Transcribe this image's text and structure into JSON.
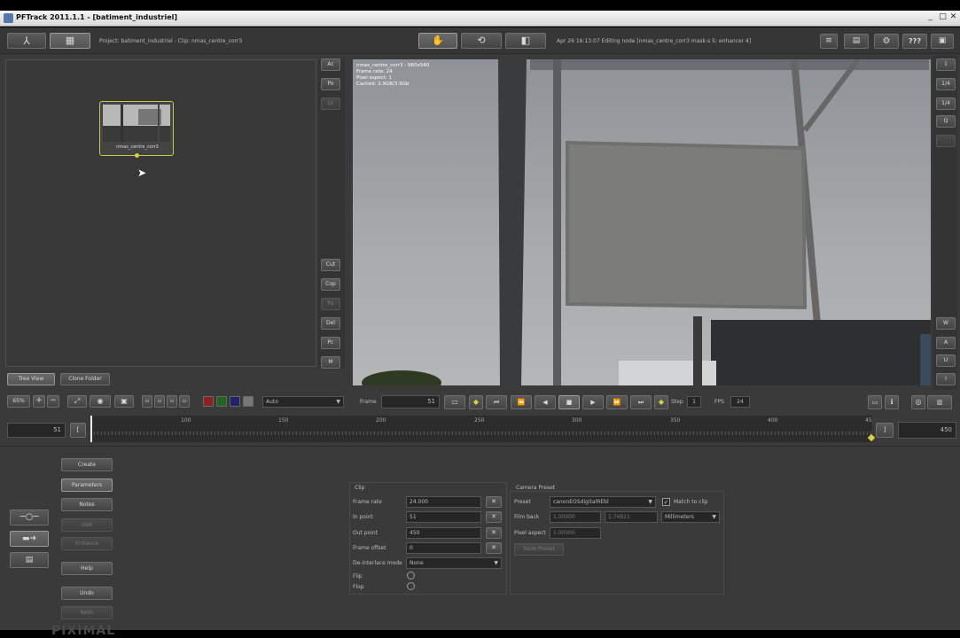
{
  "window": {
    "title": "PFTrack 2011.1.1 - [batiment_industriel]"
  },
  "header": {
    "project_info": "Project: batiment_industriel - Clip: nmas_centre_corr3",
    "status_text": "Apr 26 16:13:07 Editing node [nmas_centre_corr3 mask-s 5; enhancer 4]",
    "help_label": "???"
  },
  "node_tree": {
    "node_label": "nmas_centre_corr3",
    "side_buttons": [
      "Cut",
      "Cop",
      "Pa",
      "Del",
      "Pc",
      "M"
    ],
    "top_buttons": [
      "Ac",
      "Po",
      "Lk"
    ],
    "tabs": [
      "Tree View",
      "Clone Folder"
    ]
  },
  "viewer": {
    "overlay": [
      "nmas_centre_corr3 - 960x540",
      "Frame rate: 24",
      "Pixel aspect: 1",
      "Cached: 1.9GB/3.9Gb"
    ],
    "right_buttons": [
      "1",
      "1/4",
      "1/4",
      "Q",
      "",
      "W",
      "A",
      "U",
      "I"
    ]
  },
  "toolbar": {
    "zoom": "65%",
    "mode_select": "Auto",
    "frame_label": "Frame",
    "frame_value": "51",
    "step_label": "Step",
    "step_value": "1",
    "fps_label": "FPS",
    "fps_value": "24"
  },
  "timeline": {
    "start_frame": "51",
    "end_frame": "450",
    "ticks": [
      "100",
      "150",
      "200",
      "250",
      "300",
      "350",
      "400",
      "45"
    ]
  },
  "left_menu": [
    "Create",
    "Parameters",
    "Notes",
    "Vast",
    "Enhance",
    "Help",
    "Undo",
    "Redo"
  ],
  "clip_panel": {
    "title": "Clip",
    "rows": [
      {
        "label": "Frame rate",
        "value": "24.000"
      },
      {
        "label": "In point",
        "value": "51"
      },
      {
        "label": "Out point",
        "value": "450"
      },
      {
        "label": "Frame offset",
        "value": "0"
      }
    ],
    "deinterlace_label": "De-interlace mode",
    "deinterlace_value": "None",
    "flip_label": "Flip",
    "flop_label": "Flop"
  },
  "camera_panel": {
    "title": "Camera Preset",
    "preset_label": "Preset",
    "preset_value": "canonEOSdigitalREbl",
    "match_label": "Match to clip",
    "film_back_label": "Film back",
    "film_back_w": "1.00000",
    "film_back_h": "1.74811",
    "units_value": "Millimeters",
    "pixel_aspect_label": "Pixel aspect",
    "pixel_aspect_value": "1.00000",
    "save_preset_label": "Save Preset"
  },
  "watermark": "PIXIMAL",
  "colors": {
    "accent_yellow": "#d8d040",
    "panel_bg": "#3a3a3a"
  }
}
